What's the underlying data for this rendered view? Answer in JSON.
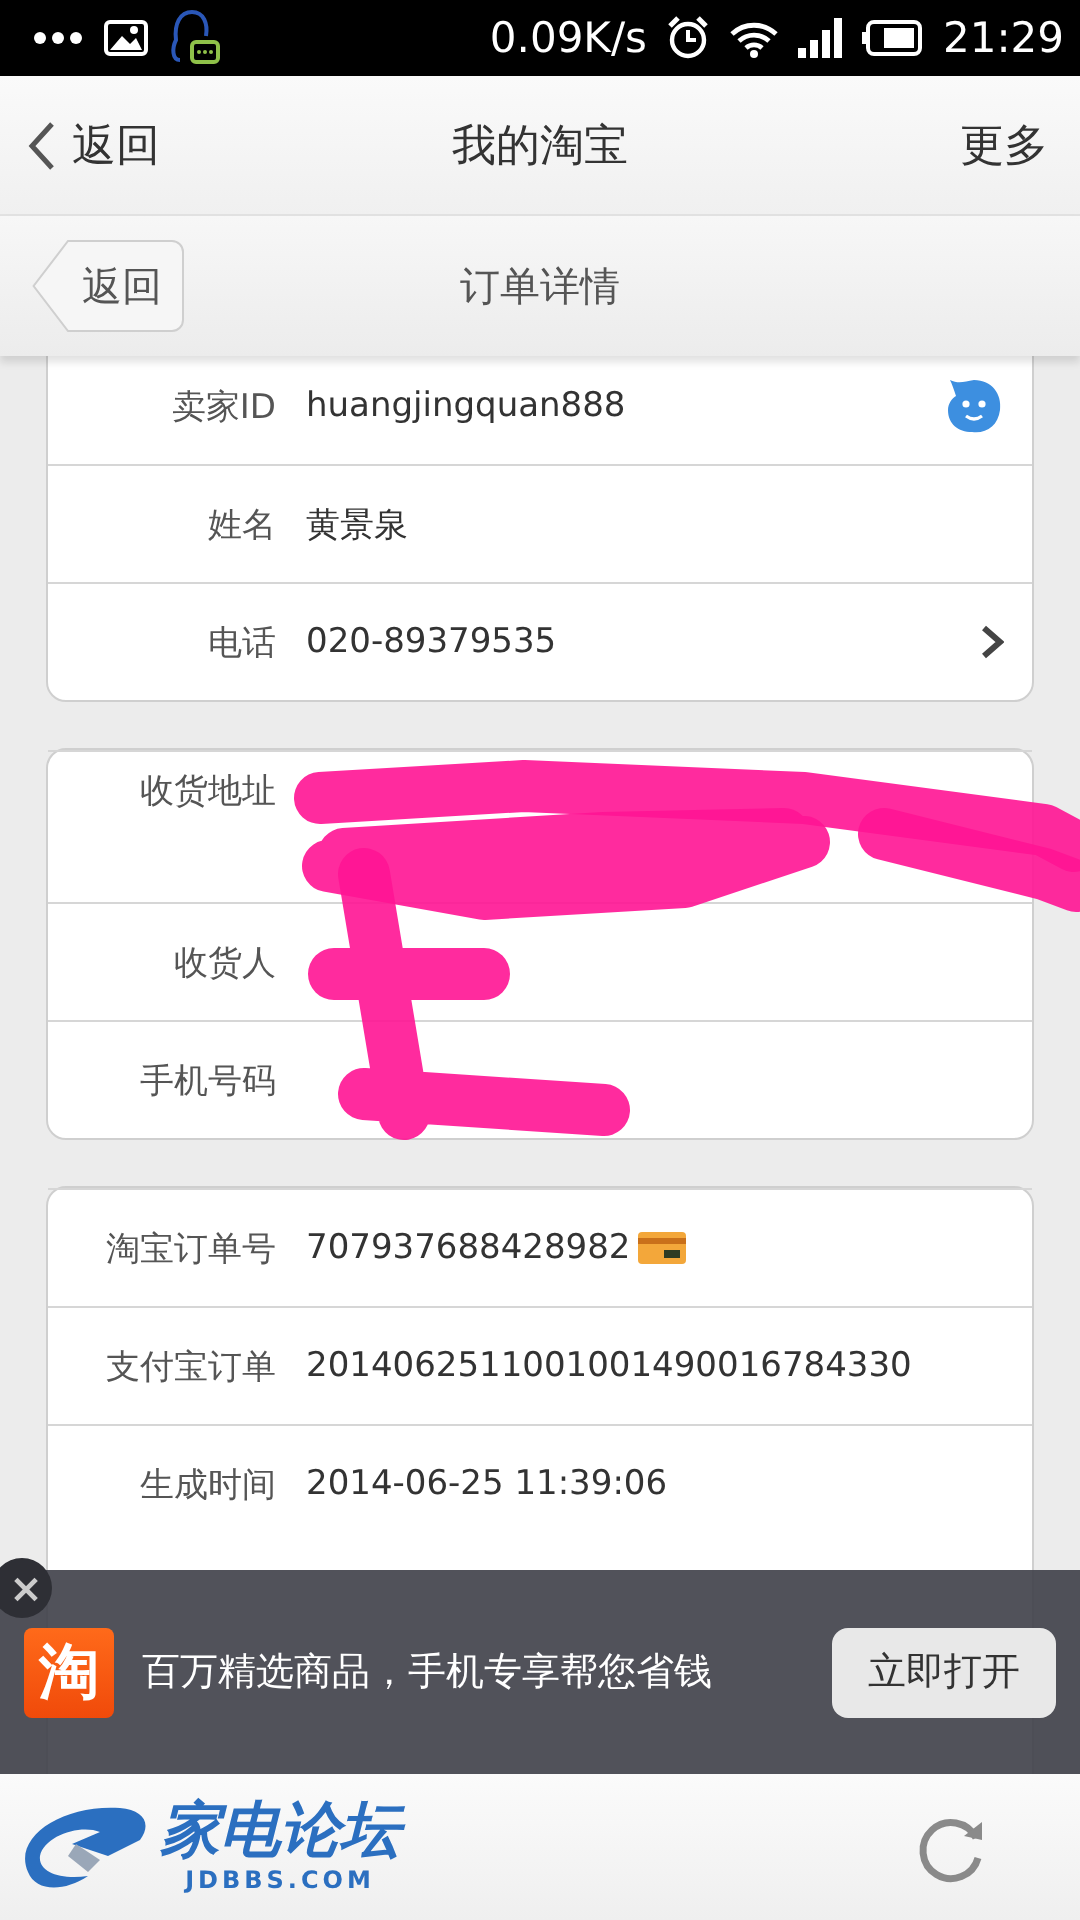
{
  "status_bar": {
    "speed": "0.09K/s",
    "time": "21:29"
  },
  "nav_bar": {
    "back": "返回",
    "title": "我的淘宝",
    "more": "更多"
  },
  "sub_header": {
    "back": "返回",
    "title": "订单详情"
  },
  "cards": [
    {
      "rows": [
        {
          "label": "卖家ID",
          "value": "huangjingquan888",
          "kind": "chat"
        },
        {
          "label": "姓名",
          "value": "黄景泉",
          "kind": "text"
        },
        {
          "label": "电话",
          "value": "020-89379535",
          "kind": "link"
        }
      ]
    },
    {
      "redacted": true,
      "rows": [
        {
          "label": "收货地址",
          "kind": "tall"
        },
        {
          "label": "收货人",
          "kind": "text"
        },
        {
          "label": "手机号码",
          "kind": "text"
        }
      ]
    },
    {
      "rows": [
        {
          "label": "淘宝订单号",
          "value": "707937688428982",
          "kind": "card"
        },
        {
          "label": "支付宝订单",
          "value": "2014062511001001490016784330",
          "kind": "text"
        },
        {
          "label": "生成时间",
          "value": "2014-06-25 11:39:06",
          "kind": "text"
        }
      ]
    }
  ],
  "ad_banner": {
    "close": "×",
    "app_icon": "淘",
    "text": "百万精选商品，手机专享帮您省钱",
    "button": "立即打开"
  },
  "bottom_bar": {
    "logo_title": "家电论坛",
    "logo_domain": "JDBBS.COM"
  }
}
